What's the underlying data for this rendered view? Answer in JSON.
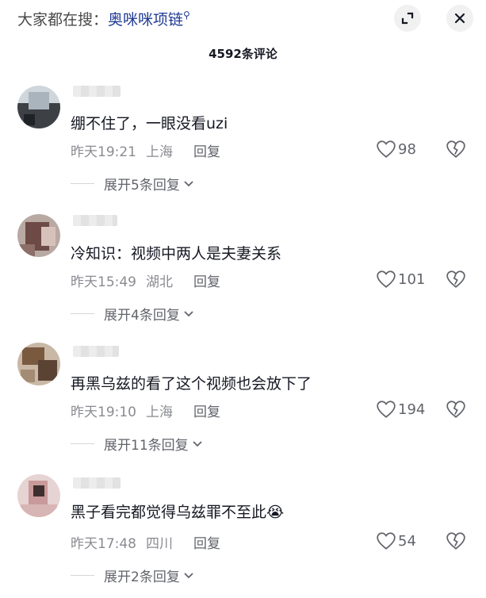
{
  "header": {
    "search_prefix": "大家都在搜：",
    "search_term": "奥咪咪项链",
    "search_glyph": "⚲",
    "comment_count": "4592条评论"
  },
  "comments": [
    {
      "text": "绷不住了，一眼没看uzi",
      "time": "昨天19:21",
      "location": "上海",
      "reply": "回复",
      "likes": "98",
      "expand": "展开5条回复"
    },
    {
      "text": "冷知识：视频中两人是夫妻关系",
      "time": "昨天15:49",
      "location": "湖北",
      "reply": "回复",
      "likes": "101",
      "expand": "展开4条回复"
    },
    {
      "text": "再黑乌兹的看了这个视频也会放下了",
      "time": "昨天19:10",
      "location": "上海",
      "reply": "回复",
      "likes": "194",
      "expand": "展开11条回复"
    },
    {
      "text": "黑子看完都觉得乌兹罪不至此",
      "emoji": "😭",
      "time": "昨天17:48",
      "location": "四川",
      "reply": "回复",
      "likes": "54",
      "expand": "展开2条回复"
    }
  ],
  "icons": {
    "collapse": "minimize-icon",
    "close": "close-icon",
    "like": "heart-icon",
    "dislike": "broken-heart-icon",
    "expand": "chevron-down-icon"
  }
}
